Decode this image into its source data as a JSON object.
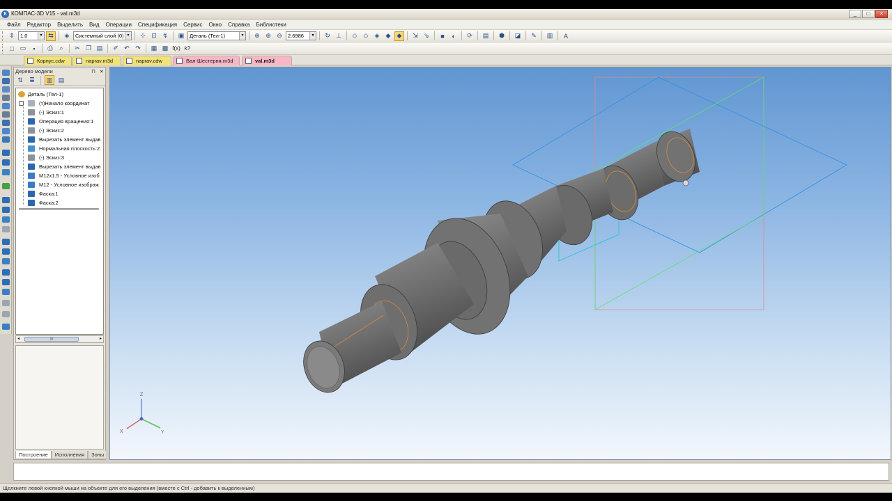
{
  "window": {
    "title": "КОМПАС-3D V15 - val.m3d",
    "app_icon": "К",
    "buttons": [
      "_",
      "□",
      "×"
    ]
  },
  "menu": [
    "Файл",
    "Редактор",
    "Выделить",
    "Вид",
    "Операции",
    "Спецификация",
    "Сервис",
    "Окно",
    "Справка",
    "Библиотеки"
  ],
  "toolbar": {
    "step_value": "1.0",
    "layer_value": "Системный слой (0)",
    "state_value": "Деталь (Тел-1)",
    "zoom_value": "2.6986",
    "fx_label": "f(x)",
    "help_label": "k?"
  },
  "doc_tabs": [
    {
      "label": "Корпус.cdw",
      "color": "#f1e27a"
    },
    {
      "label": "naprav.m3d",
      "color": "#f1e27a"
    },
    {
      "label": "naprav.cdw",
      "color": "#f1e27a"
    },
    {
      "label": "Вал-Шестерня.m3d",
      "color": "#f7b7c7"
    },
    {
      "label": "val.m3d",
      "color": "#f7b7c7"
    }
  ],
  "tree_panel": {
    "title": "Дерево модели",
    "pin": "⊓",
    "close": "×",
    "root": "Деталь (Тел-1)",
    "items": [
      {
        "label": "(т)Начало координат",
        "icon": "axis-icon"
      },
      {
        "label": "(-) Эскиз:1",
        "icon": "sketch-icon"
      },
      {
        "label": "Операция вращения:1",
        "icon": "revolve-icon"
      },
      {
        "label": "(-) Эскиз:2",
        "icon": "sketch-icon"
      },
      {
        "label": "Вырезать элемент выдав",
        "icon": "cut-extrude-icon"
      },
      {
        "label": "Нормальная плоскость:2",
        "icon": "plane-icon"
      },
      {
        "label": "(-) Эскиз:3",
        "icon": "sketch-icon"
      },
      {
        "label": "Вырезать элемент выдав",
        "icon": "cut-extrude-icon"
      },
      {
        "label": "M12x1.5 - Условное изоб",
        "icon": "thread-icon"
      },
      {
        "label": "M12 - Условное изображ",
        "icon": "thread-icon"
      },
      {
        "label": "Фаска:1",
        "icon": "chamfer-icon"
      },
      {
        "label": "Фаска:2",
        "icon": "chamfer-icon"
      }
    ],
    "scroll_thumb": "III",
    "tabs": [
      "Построение",
      "Исполнения",
      "Зоны"
    ]
  },
  "viewport": {
    "triad": {
      "z": "Z",
      "x": "X",
      "y": "Y"
    }
  },
  "status_text": "Щелкните левой кнопкой мыши на объекте для его выделения (вместе с Ctrl - добавить к выделенным)"
}
